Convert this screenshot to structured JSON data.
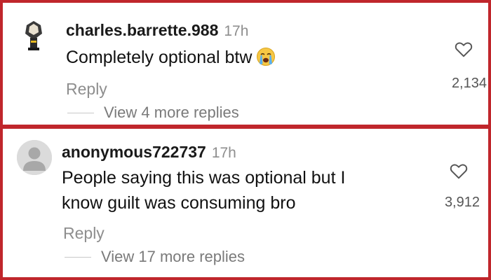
{
  "comments": [
    {
      "username": "charles.barrette.988",
      "timestamp": "17h",
      "text": "Completely optional btw",
      "emoji": "loudly-crying-face",
      "reply_label": "Reply",
      "view_replies_label": "View 4 more replies",
      "like_count": "2,134"
    },
    {
      "username": "anonymous722737",
      "timestamp": "17h",
      "text_line1": "People saying this was optional but I",
      "text_line2": "know guilt was consuming bro",
      "reply_label": "Reply",
      "view_replies_label": "View 17 more replies",
      "like_count": "3,912"
    }
  ],
  "colors": {
    "border": "#c0262c",
    "muted_text": "#8e8e8e",
    "primary_text": "#111111"
  }
}
